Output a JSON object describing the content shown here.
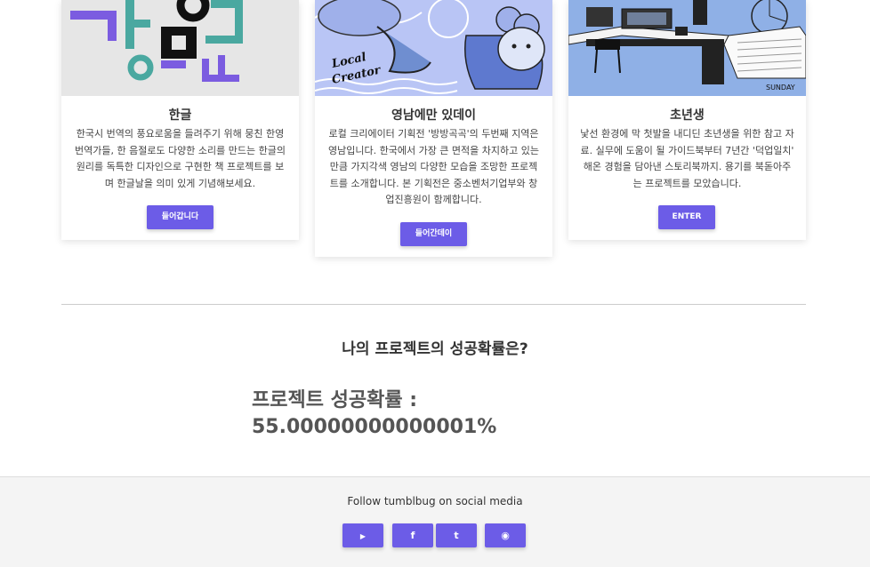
{
  "cards": [
    {
      "title": "한글",
      "description": "한국시 번역의 풍요로움을 들려주기 위해 뭉친 한영 번역가들, 한 음절로도 다양한 소리를 만드는 한글의 원리를 독특한 디자인으로 구현한 책 프로젝트를 보며 한글날을 의미 있게 기념해보세요.",
      "button_label": "들어갑니다"
    },
    {
      "title": "영남에만 있데이",
      "description": "로컬 크리에이터 기획전 '방방곡곡'의 두번째 지역은 영남입니다. 한국에서 가장 큰 면적을 차지하고 있는 만큼 가지각색 영남의 다양한 모습을 조망한 프로젝트를 소개합니다. 본 기획전은 중소벤처기업부와 창업진흥원이 함께합니다.",
      "button_label": "들어간데이",
      "image_text": [
        "Local",
        "Creator"
      ]
    },
    {
      "title": "초년생",
      "description": "낯선 환경에 막 첫발을 내디딘 초년생을 위한 참고 자료. 실무에 도움이 될 가이드북부터 7년간 '덕업일치' 해온 경험을 담아낸 스토리북까지. 용기를 북돋아주는 프로젝트를 모았습니다.",
      "button_label": "ENTER",
      "image_text": "SUNDAY"
    }
  ],
  "success": {
    "heading": "나의 프로젝트의 성공확률은?",
    "label": "프로젝트 성공확률 :",
    "value": "55.00000000000001%"
  },
  "footer": {
    "follow_text": "Follow tumblbug on social media",
    "social": [
      {
        "name": "youtube",
        "icon": "▶"
      },
      {
        "name": "facebook",
        "icon": "f"
      },
      {
        "name": "twitter",
        "icon": "t"
      },
      {
        "name": "github",
        "icon": "◉"
      }
    ]
  },
  "colors": {
    "accent": "#6c5ce7",
    "card2_bg": "#b9c5f5",
    "card3_bg": "#8fb0e6"
  }
}
